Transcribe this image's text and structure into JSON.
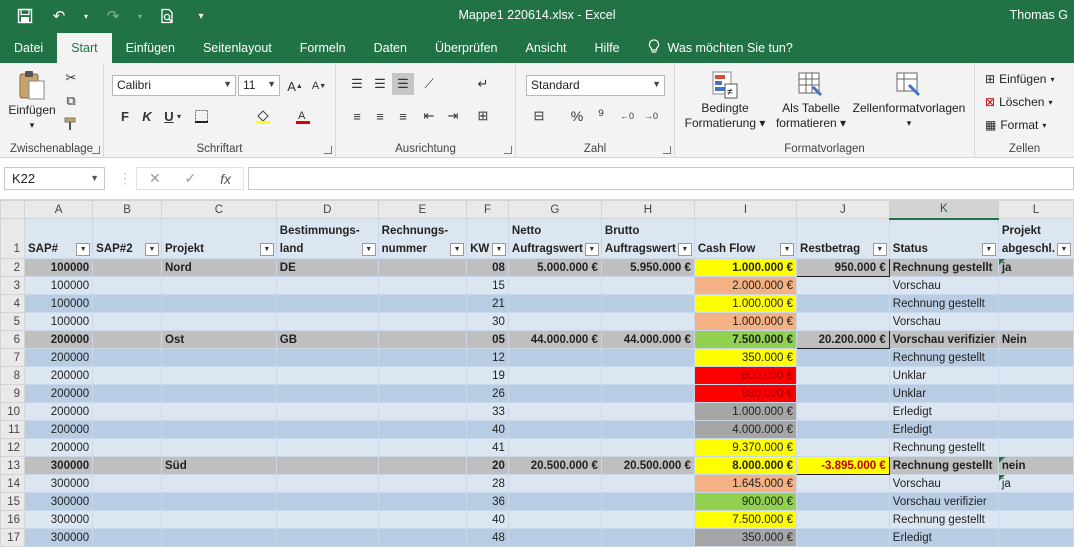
{
  "app": {
    "title": "Mappe1 220614.xlsx  -  Excel",
    "user": "Thomas G"
  },
  "ribbon_tabs": [
    "Datei",
    "Start",
    "Einfügen",
    "Seitenlayout",
    "Formeln",
    "Daten",
    "Überprüfen",
    "Ansicht",
    "Hilfe"
  ],
  "tell_me": "Was möchten Sie tun?",
  "clipboard": {
    "paste": "Einfügen",
    "label": "Zwischenablage"
  },
  "font": {
    "name": "Calibri",
    "size": "11",
    "bold": "F",
    "italic": "K",
    "underline": "U",
    "label": "Schriftart"
  },
  "alignment": {
    "label": "Ausrichtung"
  },
  "number": {
    "format": "Standard",
    "label": "Zahl"
  },
  "styles": {
    "conditional_1": "Bedingte",
    "conditional_2": "Formatierung",
    "table_1": "Als Tabelle",
    "table_2": "formatieren",
    "cellstyles": "Zellenformatvorlagen",
    "label": "Formatvorlagen"
  },
  "cells": {
    "insert": "Einfügen",
    "delete": "Löschen",
    "format": "Format",
    "label": "Zellen"
  },
  "formula_bar": {
    "name_box": "K22",
    "formula": ""
  },
  "columns": [
    "A",
    "B",
    "C",
    "D",
    "E",
    "F",
    "G",
    "H",
    "I",
    "J",
    "K",
    "L"
  ],
  "selected_column": "K",
  "header_row": {
    "number": "1",
    "A": "SAP#",
    "B": "SAP#2",
    "C": "Projekt",
    "D_1": "Bestimmungs-",
    "D_2": "land",
    "E_1": "Rechnungs-",
    "E_2": "nummer",
    "F": "KW",
    "G_1": "Netto",
    "G_2": "Auftragswert",
    "H_1": "Brutto",
    "H_2": "Auftragswert",
    "I": "Cash Flow",
    "J": "Restbetrag",
    "K": "Status",
    "L_1": "Projekt",
    "L_2": "abgeschl."
  },
  "rows": [
    {
      "n": "2",
      "A": "100000",
      "B": "",
      "C": "Nord",
      "D": "DE",
      "E": "",
      "F": "08",
      "G": "5.000.000 €",
      "H": "5.950.000 €",
      "I": "1.000.000 €",
      "J": "950.000 €",
      "K": "Rechnung gestellt",
      "L": "ja"
    },
    {
      "n": "3",
      "A": "100000",
      "B": "",
      "C": "",
      "D": "",
      "E": "",
      "F": "15",
      "G": "",
      "H": "",
      "I": "2.000.000 €",
      "J": "",
      "K": "Vorschau",
      "L": ""
    },
    {
      "n": "4",
      "A": "100000",
      "B": "",
      "C": "",
      "D": "",
      "E": "",
      "F": "21",
      "G": "",
      "H": "",
      "I": "1.000.000 €",
      "J": "",
      "K": "Rechnung gestellt",
      "L": ""
    },
    {
      "n": "5",
      "A": "100000",
      "B": "",
      "C": "",
      "D": "",
      "E": "",
      "F": "30",
      "G": "",
      "H": "",
      "I": "1.000.000 €",
      "J": "",
      "K": "Vorschau",
      "L": ""
    },
    {
      "n": "6",
      "A": "200000",
      "B": "",
      "C": "Ost",
      "D": "GB",
      "E": "",
      "F": "05",
      "G": "44.000.000 €",
      "H": "44.000.000 €",
      "I": "7.500.000 €",
      "J": "20.200.000 €",
      "K": "Vorschau verifizier",
      "L": "Nein"
    },
    {
      "n": "7",
      "A": "200000",
      "B": "",
      "C": "",
      "D": "",
      "E": "",
      "F": "12",
      "G": "",
      "H": "",
      "I": "350.000 €",
      "J": "",
      "K": "Rechnung gestellt",
      "L": ""
    },
    {
      "n": "8",
      "A": "200000",
      "B": "",
      "C": "",
      "D": "",
      "E": "",
      "F": "19",
      "G": "",
      "H": "",
      "I": "600.000 €",
      "J": "",
      "K": "Unklar",
      "L": ""
    },
    {
      "n": "9",
      "A": "200000",
      "B": "",
      "C": "",
      "D": "",
      "E": "",
      "F": "26",
      "G": "",
      "H": "",
      "I": "980.000 €",
      "J": "",
      "K": "Unklar",
      "L": ""
    },
    {
      "n": "10",
      "A": "200000",
      "B": "",
      "C": "",
      "D": "",
      "E": "",
      "F": "33",
      "G": "",
      "H": "",
      "I": "1.000.000 €",
      "J": "",
      "K": "Erledigt",
      "L": ""
    },
    {
      "n": "11",
      "A": "200000",
      "B": "",
      "C": "",
      "D": "",
      "E": "",
      "F": "40",
      "G": "",
      "H": "",
      "I": "4.000.000 €",
      "J": "",
      "K": "Erledigt",
      "L": ""
    },
    {
      "n": "12",
      "A": "200000",
      "B": "",
      "C": "",
      "D": "",
      "E": "",
      "F": "41",
      "G": "",
      "H": "",
      "I": "9.370.000 €",
      "J": "",
      "K": "Rechnung gestellt",
      "L": ""
    },
    {
      "n": "13",
      "A": "300000",
      "B": "",
      "C": "Süd",
      "D": "",
      "E": "",
      "F": "20",
      "G": "20.500.000 €",
      "H": "20.500.000 €",
      "I": "8.000.000 €",
      "J": "-3.895.000 €",
      "K": "Rechnung gestellt",
      "L": "nein"
    },
    {
      "n": "14",
      "A": "300000",
      "B": "",
      "C": "",
      "D": "",
      "E": "",
      "F": "28",
      "G": "",
      "H": "",
      "I": "1.645.000 €",
      "J": "",
      "K": "Vorschau",
      "L": "ja"
    },
    {
      "n": "15",
      "A": "300000",
      "B": "",
      "C": "",
      "D": "",
      "E": "",
      "F": "36",
      "G": "",
      "H": "",
      "I": "900.000 €",
      "J": "",
      "K": "Vorschau verifizier",
      "L": ""
    },
    {
      "n": "16",
      "A": "300000",
      "B": "",
      "C": "",
      "D": "",
      "E": "",
      "F": "40",
      "G": "",
      "H": "",
      "I": "7.500.000 €",
      "J": "",
      "K": "Rechnung gestellt",
      "L": ""
    },
    {
      "n": "17",
      "A": "300000",
      "B": "",
      "C": "",
      "D": "",
      "E": "",
      "F": "48",
      "G": "",
      "H": "",
      "I": "350.000 €",
      "J": "",
      "K": "Erledigt",
      "L": ""
    }
  ],
  "colors": {
    "excel_green": "#217346",
    "cashflow_yellow": "#ffff00",
    "cashflow_orange": "#f4b183",
    "cashflow_green": "#92d050",
    "cashflow_red": "#ff0000",
    "cashflow_gray": "#a6a6a6",
    "main_row_gray": "#bfbfbf",
    "band_light": "#dce6f1",
    "band_mid": "#b8cce4"
  }
}
